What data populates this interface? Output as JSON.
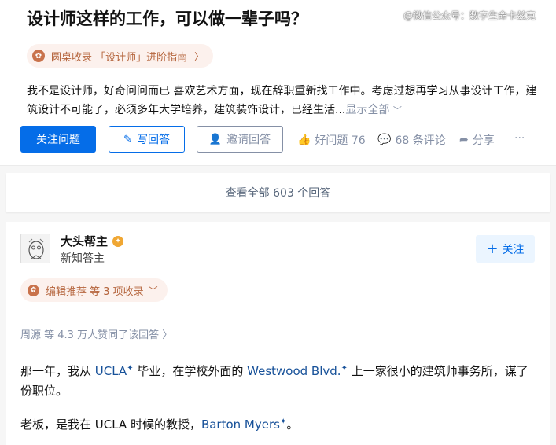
{
  "question": {
    "title": "设计师这样的工作，可以做一辈子吗？",
    "collection_pill": {
      "label": "圆桌收录 「设计师」进阶指南",
      "chevron": "〉"
    },
    "description": "我不是设计师，好奇问问而已 喜欢艺术方面，现在辞职重新找工作中。考虑过想再学习从事设计工作，建筑设计不可能了，必须多年大学培养，建筑装饰设计，已经生活...",
    "show_all": "显示全部"
  },
  "watermark": "@微信公众号：数字生命卡兹克",
  "actions": {
    "follow": "关注问题",
    "write": "写回答",
    "invite": "邀请回答",
    "good_question": "好问题 76",
    "comments": "68 条评论",
    "share": "分享",
    "more": "···"
  },
  "view_all": "查看全部 603 个回答",
  "answer": {
    "author_name": "大头帮主",
    "author_bio": "新知答主",
    "follow_button": "关注",
    "editor_pill": "编辑推荐 等 3 项收录",
    "votes_line": "周源 等 4.3 万人赞同了该回答 〉",
    "p1_a": "那一年，我从 ",
    "p1_link1": "UCLA",
    "p1_b": " 毕业，在学校外面的 ",
    "p1_link2": "Westwood Blvd.",
    "p1_c": " 上一家很小的建筑师事务所，谋了份职位。",
    "p2_a": "老板，是我在 UCLA 时候的教授，",
    "p2_link": "Barton Myers",
    "p2_b": "。"
  },
  "icons": [
    "pencil-icon",
    "invite-user-icon",
    "thumb-up-icon",
    "comment-icon",
    "share-icon",
    "plus-icon",
    "chevron-down-icon"
  ]
}
